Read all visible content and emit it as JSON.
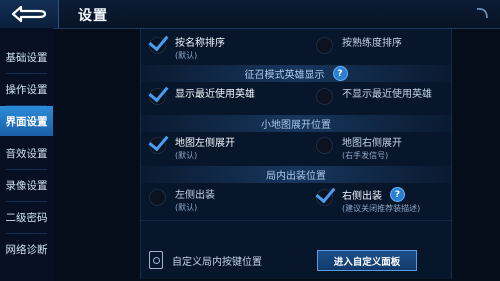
{
  "header": {
    "title": "设置"
  },
  "sidebar": {
    "items": [
      {
        "label": "基础设置",
        "active": false
      },
      {
        "label": "操作设置",
        "active": false
      },
      {
        "label": "界面设置",
        "active": true
      },
      {
        "label": "音效设置",
        "active": false
      },
      {
        "label": "录像设置",
        "active": false
      },
      {
        "label": "二级密码",
        "active": false
      },
      {
        "label": "网络诊断",
        "active": false
      }
    ]
  },
  "sections": {
    "sort": {
      "opt1": {
        "label": "按名称排序",
        "sub": "(默认)",
        "checked": true
      },
      "opt2": {
        "label": "按熟练度排序",
        "checked": false
      }
    },
    "recruit": {
      "title": "征召模式英雄显示",
      "opt1": {
        "label": "显示最近使用英雄",
        "checked": true
      },
      "opt2": {
        "label": "不显示最近使用英雄",
        "checked": false
      }
    },
    "minimap": {
      "title": "小地图展开位置",
      "opt1": {
        "label": "地图左侧展开",
        "sub": "(默认)",
        "checked": true
      },
      "opt2": {
        "label": "地图右侧展开",
        "sub": "(右手发信号)",
        "checked": false
      }
    },
    "shop": {
      "title": "局内出装位置",
      "opt1": {
        "label": "左侧出装",
        "sub": "(默认)",
        "checked": false
      },
      "opt2": {
        "label": "右侧出装",
        "sub": "(建议关闭推荐装描述)",
        "checked": true
      }
    },
    "custom": {
      "label": "自定义局内按键位置",
      "button": "进入自定义面板"
    }
  },
  "help_symbol": "?",
  "colors": {
    "accent": "#2c8cd8",
    "background": "#060d1a",
    "check": "#4a9ef2"
  }
}
